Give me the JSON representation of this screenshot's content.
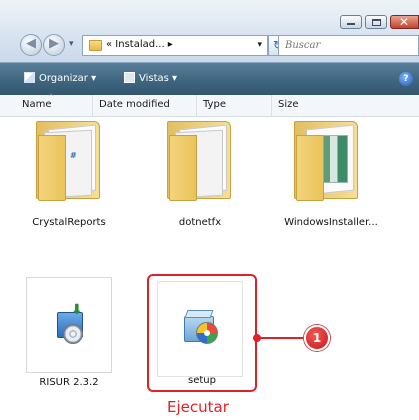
{
  "window": {
    "controls": {
      "minimize_icon": "minimize-icon",
      "maximize_icon": "maximize-icon",
      "close_icon": "close-icon",
      "close_glyph": "✕"
    }
  },
  "address_bar": {
    "back_glyph": "◀",
    "forward_glyph": "▶",
    "history_glyph": "▾",
    "breadcrumb": "« Instalad... ▸",
    "dropdown_glyph": "▾",
    "refresh_glyph": "↻",
    "search_placeholder": "Buscar"
  },
  "command_bar": {
    "organize_label": "Organizar ▾",
    "views_label": "Vistas ▾",
    "help_glyph": "?"
  },
  "columns": {
    "name": "Name",
    "date_modified": "Date modified",
    "type": "Type",
    "size": "Size",
    "sort_glyph": "^"
  },
  "items": [
    {
      "name": "CrystalReports",
      "kind": "folder"
    },
    {
      "name": "dotnetfx",
      "kind": "folder"
    },
    {
      "name": "WindowsInstaller...",
      "kind": "folder"
    },
    {
      "name": "RISUR 2.3.2",
      "kind": "installer"
    },
    {
      "name": "setup",
      "kind": "setup",
      "selected": true
    }
  ],
  "annotation": {
    "step_number": "1",
    "caption": "Ejecutar",
    "color": "#e0212a"
  }
}
